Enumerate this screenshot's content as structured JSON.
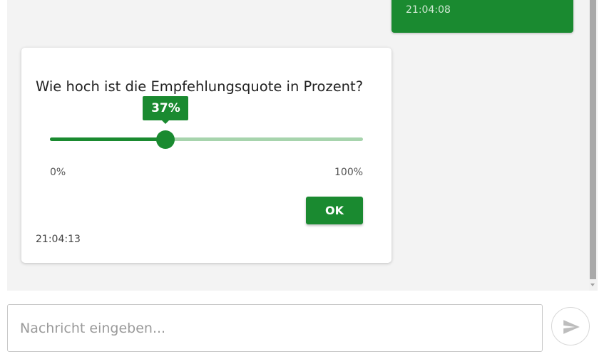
{
  "chat": {
    "user_message": {
      "time": "21:04:08"
    },
    "bot_message": {
      "question": "Wie hoch ist die Empfehlungsquote in Prozent?",
      "slider": {
        "value": 37,
        "value_label": "37%",
        "min": 0,
        "max": 100,
        "min_label": "0%",
        "max_label": "100%"
      },
      "ok_label": "OK",
      "time": "21:04:13"
    }
  },
  "composer": {
    "placeholder": "Nachricht eingeben...",
    "value": "",
    "send_icon": "send-icon"
  },
  "colors": {
    "accent": "#1a8a30",
    "track": "#a7d4ad",
    "chat_background": "#f3f3f3"
  }
}
